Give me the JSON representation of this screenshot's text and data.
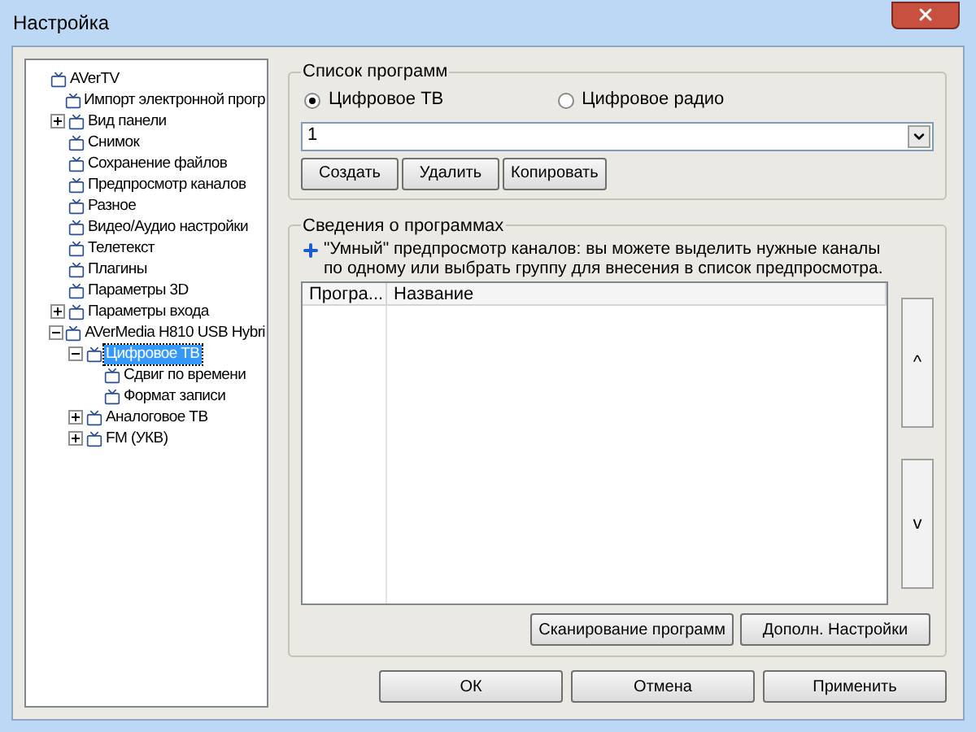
{
  "window": {
    "title": "Настройка"
  },
  "tree": [
    {
      "label": "AVerTV",
      "selected": false,
      "children": [
        {
          "label": "Импорт электронной прогр",
          "selected": false
        },
        {
          "label": "Вид панели",
          "selected": false,
          "expanded": false
        },
        {
          "label": "Снимок",
          "selected": false
        },
        {
          "label": "Сохранение файлов",
          "selected": false
        },
        {
          "label": "Предпросмотр каналов",
          "selected": false
        },
        {
          "label": "Разное",
          "selected": false
        },
        {
          "label": "Видео/Аудио настройки",
          "selected": false
        },
        {
          "label": "Телетекст",
          "selected": false
        },
        {
          "label": "Плагины",
          "selected": false
        },
        {
          "label": "Параметры 3D",
          "selected": false
        },
        {
          "label": "Параметры входа",
          "selected": false,
          "expanded": false
        },
        {
          "label": "AVerMedia H810 USB Hybri",
          "selected": false,
          "expanded": true,
          "children": [
            {
              "label": "Цифровое ТВ",
              "selected": true,
              "expanded": true,
              "children": [
                {
                  "label": "Сдвиг по времени",
                  "selected": false
                },
                {
                  "label": "Формат записи",
                  "selected": false
                }
              ]
            },
            {
              "label": "Аналоговое ТВ",
              "selected": false,
              "expanded": false
            },
            {
              "label": "FM (УКВ)",
              "selected": false,
              "expanded": false
            }
          ]
        }
      ]
    }
  ],
  "program_list": {
    "title": "Список программ",
    "radios": [
      {
        "label": "Цифровое ТВ",
        "selected": true
      },
      {
        "label": "Цифровое радио",
        "selected": false
      }
    ],
    "combo_value": "1",
    "buttons": [
      "Создать",
      "Удалить",
      "Копировать"
    ]
  },
  "program_info": {
    "title": "Сведения о программах",
    "hint": "\"Умный\" предпросмотр каналов: вы можете выделить нужные каналы по одному или выбрать группу для внесения в список предпросмотра.",
    "columns": [
      "Програ...",
      "Название"
    ],
    "scroll_up": "^",
    "scroll_down": "v",
    "buttons": [
      "Сканирование программ",
      "Дополн. Настройки"
    ]
  },
  "buttons": [
    "ОК",
    "Отмена",
    "Применить"
  ]
}
